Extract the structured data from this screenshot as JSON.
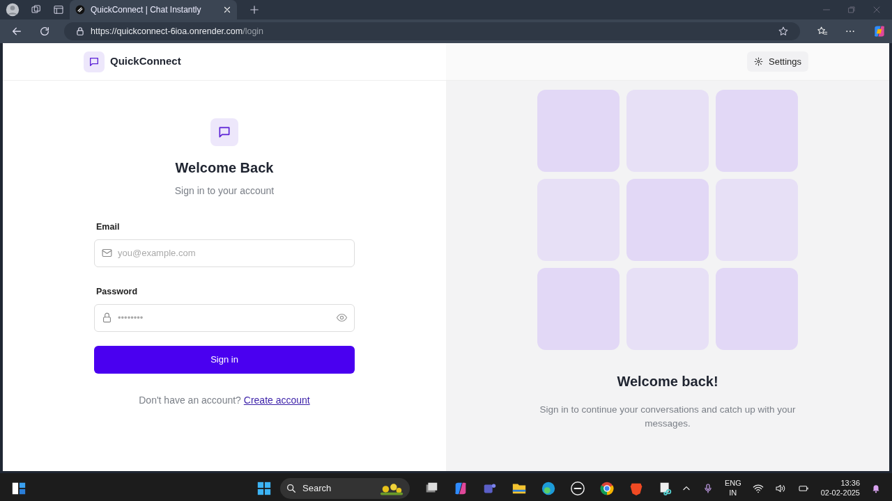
{
  "browser": {
    "tab": {
      "title": "QuickConnect | Chat Instantly",
      "selected": true
    },
    "url": {
      "host": "https://quickconnect-6ioa.onrender.com",
      "path": "/login"
    }
  },
  "header": {
    "brand": "QuickConnect",
    "settings": "Settings"
  },
  "login": {
    "title": "Welcome Back",
    "subtitle": "Sign in to your account",
    "fields": [
      {
        "kind": "email",
        "label": "Email",
        "placeholder": "you@example.com"
      },
      {
        "kind": "password",
        "label": "Password",
        "placeholder": "••••••••"
      }
    ],
    "submit": "Sign in",
    "prompt": "Don't have an account?",
    "link": "Create account"
  },
  "aside": {
    "title": "Welcome back!",
    "text": "Sign in to continue your conversations and catch up with your messages."
  },
  "taskbar": {
    "search": "Search",
    "language": "ENG",
    "region": "IN",
    "time": "13:36",
    "date": "02-02-2025"
  }
}
